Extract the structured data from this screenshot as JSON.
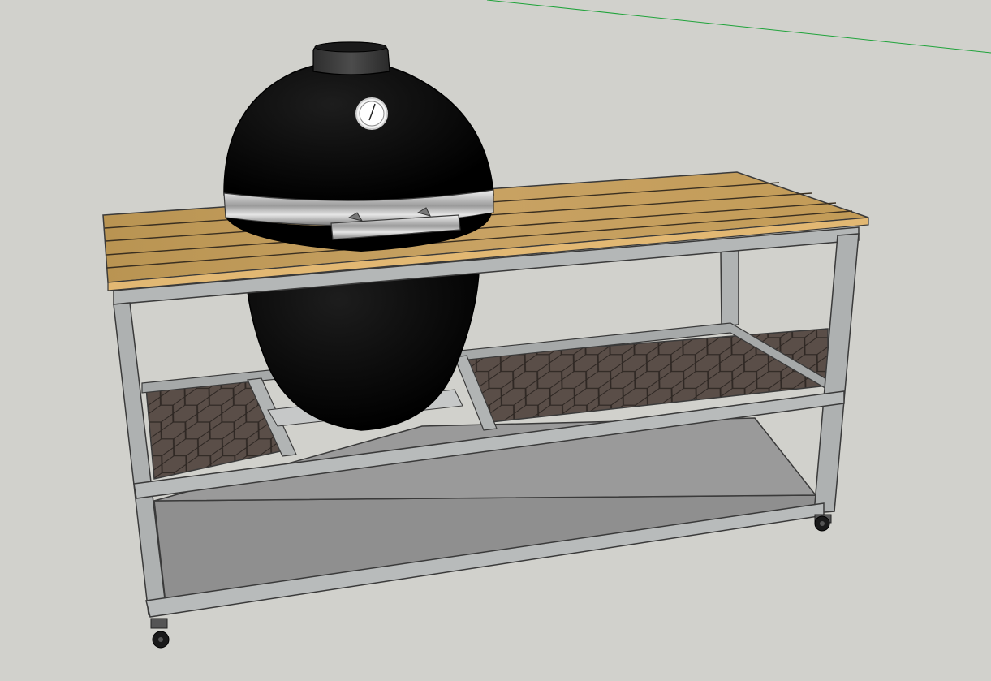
{
  "viewport": {
    "background": "#d1d1cc",
    "green_axis_color": "#1fa33a"
  },
  "model": {
    "frame_color": "#a9acac",
    "frame_edge": "#3a3a3a",
    "wood_color": "#c49a55",
    "wood_dark": "#9a7b45",
    "grill_color": "#050505",
    "band_color": "#c9c9c9",
    "hex_shelf_color": "#574a44",
    "bottom_shelf_color": "#8e8e8e"
  }
}
